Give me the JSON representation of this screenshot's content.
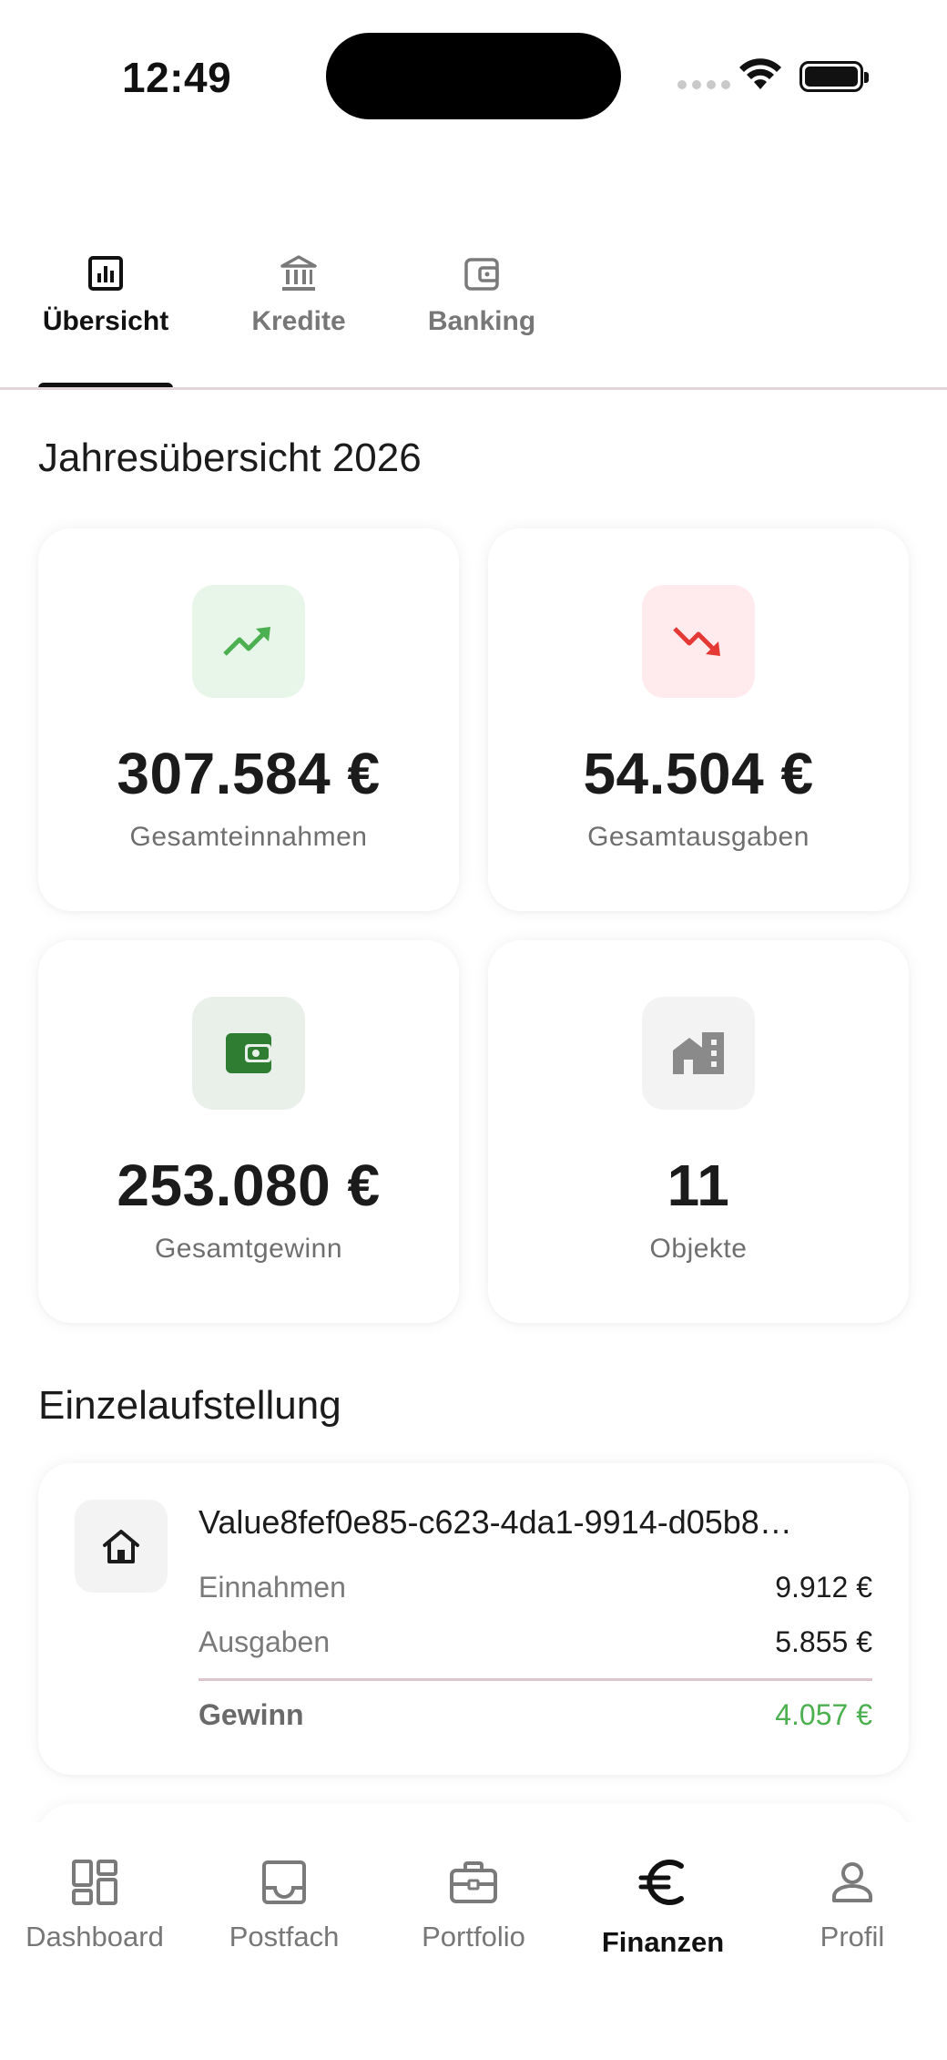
{
  "status_bar": {
    "time": "12:49"
  },
  "tabs": [
    {
      "label": "Übersicht",
      "icon": "chart-icon",
      "active": true
    },
    {
      "label": "Kredite",
      "icon": "bank-icon",
      "active": false
    },
    {
      "label": "Banking",
      "icon": "wallet-icon",
      "active": false
    }
  ],
  "overview": {
    "title": "Jahresübersicht 2026",
    "income": {
      "value": "307.584 €",
      "label": "Gesamteinnahmen",
      "icon": "trending-up-icon",
      "color": "#4caf50",
      "bg": "#e8f5e9"
    },
    "expenses": {
      "value": "54.504 €",
      "label": "Gesamtausgaben",
      "icon": "trending-down-icon",
      "color": "#e53935",
      "bg": "#ffebee"
    },
    "profit": {
      "value": "253.080 €",
      "label": "Gesamtgewinn",
      "icon": "wallet-icon",
      "color": "#2e7d32",
      "bg": "#e8f0e9"
    },
    "objects": {
      "value": "11",
      "label": "Objekte",
      "icon": "buildings-icon",
      "color": "#8a8a8a",
      "bg": "#f3f3f3"
    }
  },
  "breakdown": {
    "title": "Einzelaufstellung",
    "items": [
      {
        "name": "Value8fef0e85-c623-4da1-9914-d05b8…",
        "income_label": "Einnahmen",
        "income_value": "9.912 €",
        "expenses_label": "Ausgaben",
        "expenses_value": "5.855 €",
        "profit_label": "Gewinn",
        "profit_value": "4.057 €"
      }
    ]
  },
  "bottom_nav": [
    {
      "label": "Dashboard",
      "icon": "dashboard-icon",
      "active": false
    },
    {
      "label": "Postfach",
      "icon": "inbox-icon",
      "active": false
    },
    {
      "label": "Portfolio",
      "icon": "briefcase-icon",
      "active": false
    },
    {
      "label": "Finanzen",
      "icon": "euro-icon",
      "active": true
    },
    {
      "label": "Profil",
      "icon": "person-icon",
      "active": false
    }
  ]
}
